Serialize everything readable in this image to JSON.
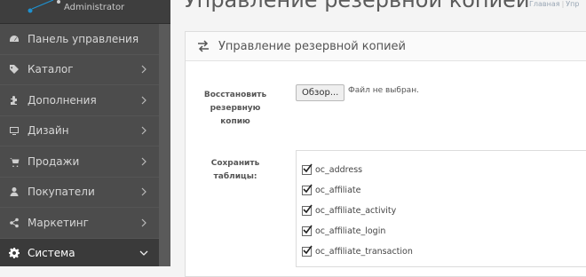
{
  "app": {
    "role": "Administrator"
  },
  "header": {
    "title": "Управление резервной копией",
    "breadcrumb": [
      "Главная",
      "Упр"
    ]
  },
  "sidebar": {
    "items": [
      {
        "label": "Панель управления",
        "icon": "dashboard-icon",
        "chevron": false,
        "active": false
      },
      {
        "label": "Каталог",
        "icon": "tag-icon",
        "chevron": true,
        "active": false
      },
      {
        "label": "Дополнения",
        "icon": "puzzle-icon",
        "chevron": true,
        "active": false
      },
      {
        "label": "Дизайн",
        "icon": "monitor-icon",
        "chevron": true,
        "active": false
      },
      {
        "label": "Продажи",
        "icon": "cart-icon",
        "chevron": true,
        "active": false
      },
      {
        "label": "Покупатели",
        "icon": "user-icon",
        "chevron": true,
        "active": false
      },
      {
        "label": "Маркетинг",
        "icon": "share-icon",
        "chevron": true,
        "active": false
      },
      {
        "label": "Система",
        "icon": "gear-icon",
        "chevron": true,
        "active": true
      }
    ]
  },
  "panel": {
    "title": "Управление резервной копией",
    "icon": "exchange-icon",
    "restore_label": [
      "Восстановить",
      "резервную",
      "копию"
    ],
    "file_button": "Обзор...",
    "file_status": "Файл не выбран.",
    "save_label": [
      "Сохранить",
      "таблицы:"
    ],
    "tables": [
      {
        "name": "oc_address",
        "checked": true
      },
      {
        "name": "oc_affiliate",
        "checked": true
      },
      {
        "name": "oc_affiliate_activity",
        "checked": true
      },
      {
        "name": "oc_affiliate_login",
        "checked": true
      },
      {
        "name": "oc_affiliate_transaction",
        "checked": true
      }
    ]
  },
  "colors": {
    "sidebar_bg": "#4c4c4c",
    "active_bg": "#3a3a3a",
    "panel_bg": "#ffffff",
    "brand_blue": "#1e91cf"
  }
}
